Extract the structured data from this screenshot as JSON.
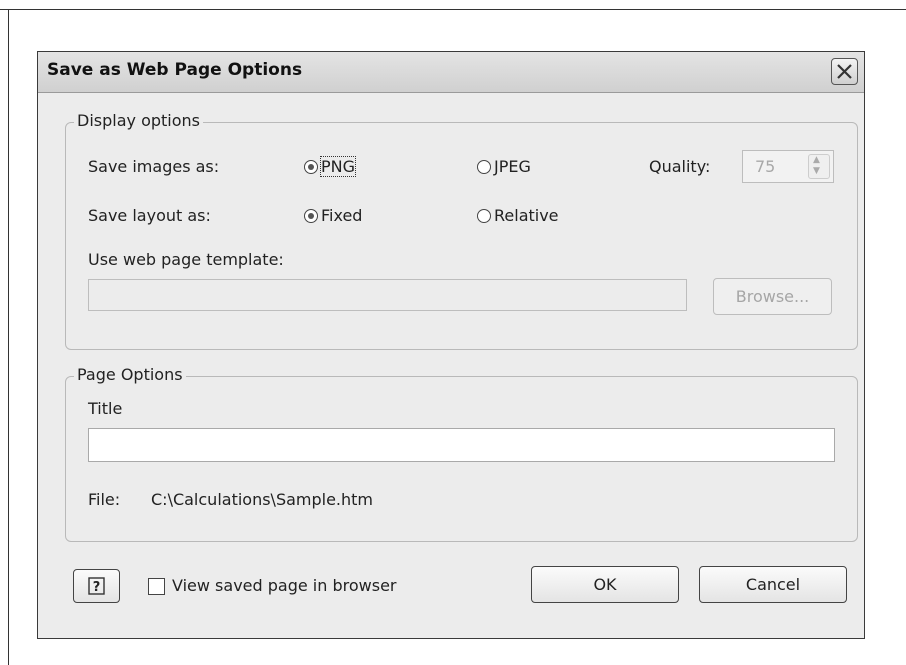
{
  "dialog": {
    "title": "Save as Web Page Options",
    "close_glyph": "close-icon"
  },
  "display_options": {
    "legend": "Display options",
    "save_images_label": "Save images as:",
    "png_label": "PNG",
    "jpeg_label": "JPEG",
    "images_selected": "PNG",
    "quality_label": "Quality:",
    "quality_value": "75",
    "save_layout_label": "Save layout as:",
    "fixed_label": "Fixed",
    "relative_label": "Relative",
    "layout_selected": "Fixed",
    "template_label": "Use web page template:",
    "template_value": "",
    "browse_label": "Browse..."
  },
  "page_options": {
    "legend": "Page Options",
    "title_label": "Title",
    "title_value": "",
    "file_label": "File:",
    "file_value": "C:\\Calculations\\Sample.htm"
  },
  "footer": {
    "help_icon": "help-icon",
    "view_browser_label": "View saved page in browser",
    "view_browser_checked": false,
    "ok_label": "OK",
    "cancel_label": "Cancel"
  }
}
